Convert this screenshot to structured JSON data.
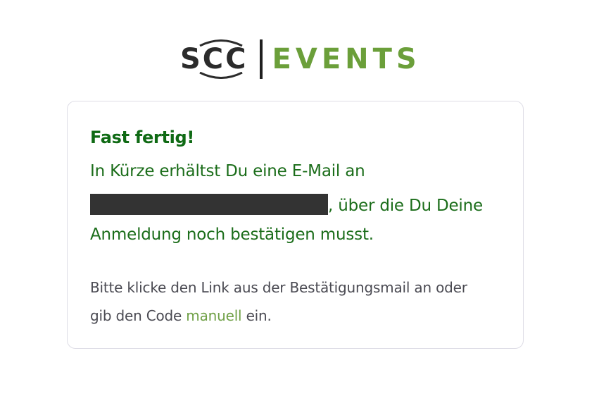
{
  "logo": {
    "brand": "SCC",
    "product": "EVENTS",
    "brand_color": "#2b2b2b",
    "product_color": "#6b9f3a"
  },
  "card": {
    "title": "Fast fertig!",
    "message_line1": "In Kürze erhältst Du eine E-Mail an",
    "message_line2_suffix": ", über die Du Deine",
    "message_line3": "Anmeldung noch bestätigen musst.",
    "hint_line1": "Bitte klicke den Link aus der Bestätigungsmail an oder",
    "hint_line2_prefix": "gib den Code ",
    "hint_link": "manuell",
    "hint_line2_suffix": " ein.",
    "title_color": "#0f6a14",
    "link_color": "#6fa046"
  }
}
